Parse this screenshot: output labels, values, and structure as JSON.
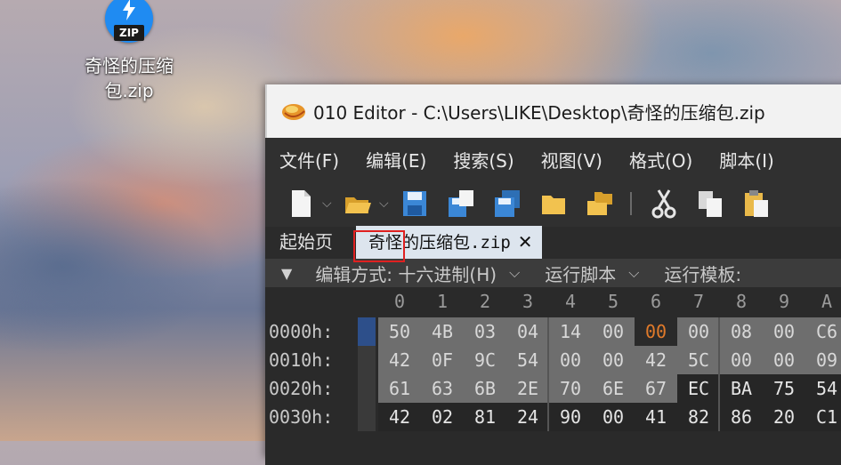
{
  "desktop": {
    "icon_tag": "ZIP",
    "icon_label_line1": "奇怪的压缩",
    "icon_label_line2": "包.zip"
  },
  "window": {
    "title": "010 Editor - C:\\Users\\LIKE\\Desktop\\奇怪的压缩包.zip"
  },
  "menu": [
    "文件(F)",
    "编辑(E)",
    "搜索(S)",
    "视图(V)",
    "格式(O)",
    "脚本(I)"
  ],
  "toolbar": {
    "icons": [
      "new-file-icon",
      "open-folder-icon",
      "save-icon",
      "save-as-icon",
      "save-all-icon",
      "folder-icon",
      "open-multiple-icon",
      "cut-icon",
      "copy-icon",
      "paste-icon"
    ]
  },
  "tabs": {
    "start": "起始页",
    "active": "奇怪的压缩包.zip",
    "close": "✕"
  },
  "options": {
    "arrow": "▼",
    "edit_mode": "编辑方式: 十六进制(H)",
    "run_script": "运行脚本",
    "run_template": "运行模板:"
  },
  "hex": {
    "columns": [
      "0",
      "1",
      "2",
      "3",
      "4",
      "5",
      "6",
      "7",
      "8",
      "9",
      "A"
    ],
    "rows": [
      {
        "addr": "0000h:",
        "bytes": [
          "50",
          "4B",
          "03",
          "04",
          "14",
          "00",
          "00",
          "00",
          "08",
          "00",
          "C6"
        ]
      },
      {
        "addr": "0010h:",
        "bytes": [
          "42",
          "0F",
          "9C",
          "54",
          "00",
          "00",
          "42",
          "5C",
          "00",
          "00",
          "09"
        ]
      },
      {
        "addr": "0020h:",
        "bytes": [
          "61",
          "63",
          "6B",
          "2E",
          "70",
          "6E",
          "67",
          "EC",
          "BA",
          "75",
          "54"
        ]
      },
      {
        "addr": "0030h:",
        "bytes": [
          "42",
          "02",
          "81",
          "24",
          "90",
          "00",
          "41",
          "82",
          "86",
          "20",
          "C1"
        ]
      }
    ],
    "highlight_color": "#e07a2a",
    "selection_color": "#6e6e6e"
  }
}
